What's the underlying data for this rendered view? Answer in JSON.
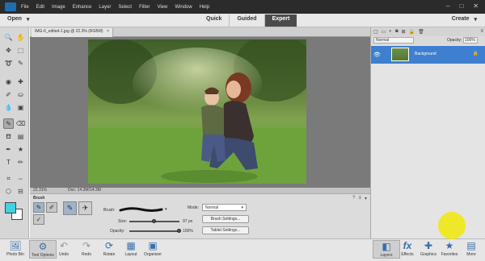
{
  "menubar": {
    "items": [
      "File",
      "Edit",
      "Image",
      "Enhance",
      "Layer",
      "Select",
      "Filter",
      "View",
      "Window",
      "Help"
    ]
  },
  "modebar": {
    "open_label": "Open",
    "modes": [
      "Quick",
      "Guided",
      "Expert"
    ],
    "active_mode": "Expert",
    "create_label": "Create"
  },
  "document": {
    "tab_title": "IMG-6_edited-1.jpg @ 22.3% (RGB/8)",
    "tab_close": "×",
    "zoom": "22.31%",
    "doc_info": "Doc: 14.3M/14.3M"
  },
  "tool_options": {
    "title": "Brush",
    "brush_label": "Brush:",
    "size_label": "Size:",
    "size_value": "97 px",
    "size_fraction": 0.5,
    "opacity_label": "Opacity:",
    "opacity_value": "100%",
    "opacity_fraction": 1.0,
    "mode_label": "Mode:",
    "mode_value": "Normal",
    "brush_settings": "Brush Settings...",
    "tablet_settings": "Tablet Settings..."
  },
  "layers_panel": {
    "blend_mode": "Normal",
    "opacity_label": "Opacity:",
    "opacity_value": "100%",
    "layers": [
      {
        "name": "Background"
      }
    ]
  },
  "bottombar": {
    "left": [
      {
        "label": "Photo Bin",
        "icon": "photo-bin-icon"
      },
      {
        "label": "Tool Options",
        "icon": "tool-options-icon"
      },
      {
        "label": "Undo",
        "icon": "undo-icon"
      },
      {
        "label": "Redo",
        "icon": "redo-icon"
      },
      {
        "label": "Rotate",
        "icon": "rotate-icon"
      },
      {
        "label": "Layout",
        "icon": "layout-icon"
      },
      {
        "label": "Organizer",
        "icon": "organizer-icon"
      }
    ],
    "right": [
      {
        "label": "Layers",
        "icon": "layers-icon"
      },
      {
        "label": "Effects",
        "icon": "effects-icon"
      },
      {
        "label": "Graphics",
        "icon": "graphics-icon"
      },
      {
        "label": "Favorites",
        "icon": "favorites-icon"
      },
      {
        "label": "More",
        "icon": "more-icon"
      }
    ]
  },
  "colors": {
    "foreground": "#3fd3e2",
    "background": "#ffffff",
    "accent": "#3e7fcf"
  }
}
